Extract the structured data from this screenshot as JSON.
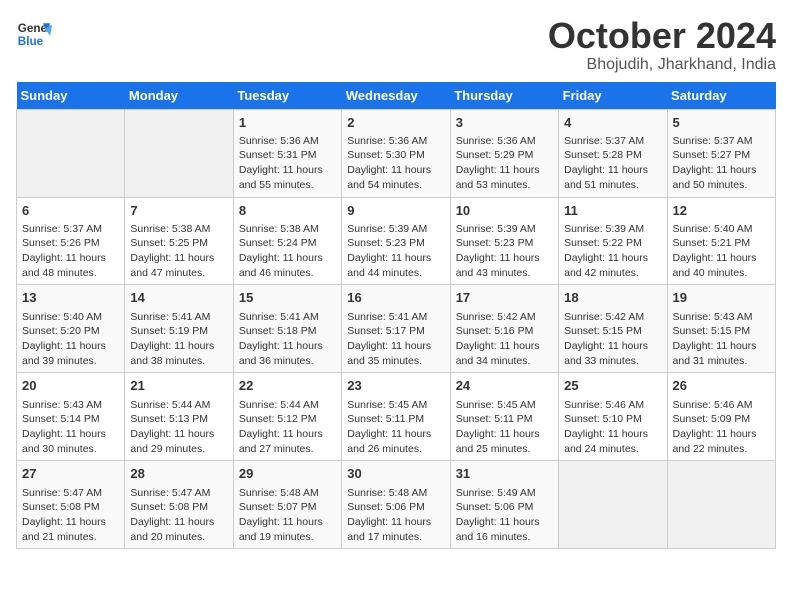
{
  "header": {
    "logo_line1": "General",
    "logo_line2": "Blue",
    "month": "October 2024",
    "location": "Bhojudih, Jharkhand, India"
  },
  "weekdays": [
    "Sunday",
    "Monday",
    "Tuesday",
    "Wednesday",
    "Thursday",
    "Friday",
    "Saturday"
  ],
  "weeks": [
    [
      {
        "day": "",
        "content": ""
      },
      {
        "day": "",
        "content": ""
      },
      {
        "day": "1",
        "content": "Sunrise: 5:36 AM\nSunset: 5:31 PM\nDaylight: 11 hours\nand 55 minutes."
      },
      {
        "day": "2",
        "content": "Sunrise: 5:36 AM\nSunset: 5:30 PM\nDaylight: 11 hours\nand 54 minutes."
      },
      {
        "day": "3",
        "content": "Sunrise: 5:36 AM\nSunset: 5:29 PM\nDaylight: 11 hours\nand 53 minutes."
      },
      {
        "day": "4",
        "content": "Sunrise: 5:37 AM\nSunset: 5:28 PM\nDaylight: 11 hours\nand 51 minutes."
      },
      {
        "day": "5",
        "content": "Sunrise: 5:37 AM\nSunset: 5:27 PM\nDaylight: 11 hours\nand 50 minutes."
      }
    ],
    [
      {
        "day": "6",
        "content": "Sunrise: 5:37 AM\nSunset: 5:26 PM\nDaylight: 11 hours\nand 48 minutes."
      },
      {
        "day": "7",
        "content": "Sunrise: 5:38 AM\nSunset: 5:25 PM\nDaylight: 11 hours\nand 47 minutes."
      },
      {
        "day": "8",
        "content": "Sunrise: 5:38 AM\nSunset: 5:24 PM\nDaylight: 11 hours\nand 46 minutes."
      },
      {
        "day": "9",
        "content": "Sunrise: 5:39 AM\nSunset: 5:23 PM\nDaylight: 11 hours\nand 44 minutes."
      },
      {
        "day": "10",
        "content": "Sunrise: 5:39 AM\nSunset: 5:23 PM\nDaylight: 11 hours\nand 43 minutes."
      },
      {
        "day": "11",
        "content": "Sunrise: 5:39 AM\nSunset: 5:22 PM\nDaylight: 11 hours\nand 42 minutes."
      },
      {
        "day": "12",
        "content": "Sunrise: 5:40 AM\nSunset: 5:21 PM\nDaylight: 11 hours\nand 40 minutes."
      }
    ],
    [
      {
        "day": "13",
        "content": "Sunrise: 5:40 AM\nSunset: 5:20 PM\nDaylight: 11 hours\nand 39 minutes."
      },
      {
        "day": "14",
        "content": "Sunrise: 5:41 AM\nSunset: 5:19 PM\nDaylight: 11 hours\nand 38 minutes."
      },
      {
        "day": "15",
        "content": "Sunrise: 5:41 AM\nSunset: 5:18 PM\nDaylight: 11 hours\nand 36 minutes."
      },
      {
        "day": "16",
        "content": "Sunrise: 5:41 AM\nSunset: 5:17 PM\nDaylight: 11 hours\nand 35 minutes."
      },
      {
        "day": "17",
        "content": "Sunrise: 5:42 AM\nSunset: 5:16 PM\nDaylight: 11 hours\nand 34 minutes."
      },
      {
        "day": "18",
        "content": "Sunrise: 5:42 AM\nSunset: 5:15 PM\nDaylight: 11 hours\nand 33 minutes."
      },
      {
        "day": "19",
        "content": "Sunrise: 5:43 AM\nSunset: 5:15 PM\nDaylight: 11 hours\nand 31 minutes."
      }
    ],
    [
      {
        "day": "20",
        "content": "Sunrise: 5:43 AM\nSunset: 5:14 PM\nDaylight: 11 hours\nand 30 minutes."
      },
      {
        "day": "21",
        "content": "Sunrise: 5:44 AM\nSunset: 5:13 PM\nDaylight: 11 hours\nand 29 minutes."
      },
      {
        "day": "22",
        "content": "Sunrise: 5:44 AM\nSunset: 5:12 PM\nDaylight: 11 hours\nand 27 minutes."
      },
      {
        "day": "23",
        "content": "Sunrise: 5:45 AM\nSunset: 5:11 PM\nDaylight: 11 hours\nand 26 minutes."
      },
      {
        "day": "24",
        "content": "Sunrise: 5:45 AM\nSunset: 5:11 PM\nDaylight: 11 hours\nand 25 minutes."
      },
      {
        "day": "25",
        "content": "Sunrise: 5:46 AM\nSunset: 5:10 PM\nDaylight: 11 hours\nand 24 minutes."
      },
      {
        "day": "26",
        "content": "Sunrise: 5:46 AM\nSunset: 5:09 PM\nDaylight: 11 hours\nand 22 minutes."
      }
    ],
    [
      {
        "day": "27",
        "content": "Sunrise: 5:47 AM\nSunset: 5:08 PM\nDaylight: 11 hours\nand 21 minutes."
      },
      {
        "day": "28",
        "content": "Sunrise: 5:47 AM\nSunset: 5:08 PM\nDaylight: 11 hours\nand 20 minutes."
      },
      {
        "day": "29",
        "content": "Sunrise: 5:48 AM\nSunset: 5:07 PM\nDaylight: 11 hours\nand 19 minutes."
      },
      {
        "day": "30",
        "content": "Sunrise: 5:48 AM\nSunset: 5:06 PM\nDaylight: 11 hours\nand 17 minutes."
      },
      {
        "day": "31",
        "content": "Sunrise: 5:49 AM\nSunset: 5:06 PM\nDaylight: 11 hours\nand 16 minutes."
      },
      {
        "day": "",
        "content": ""
      },
      {
        "day": "",
        "content": ""
      }
    ]
  ]
}
